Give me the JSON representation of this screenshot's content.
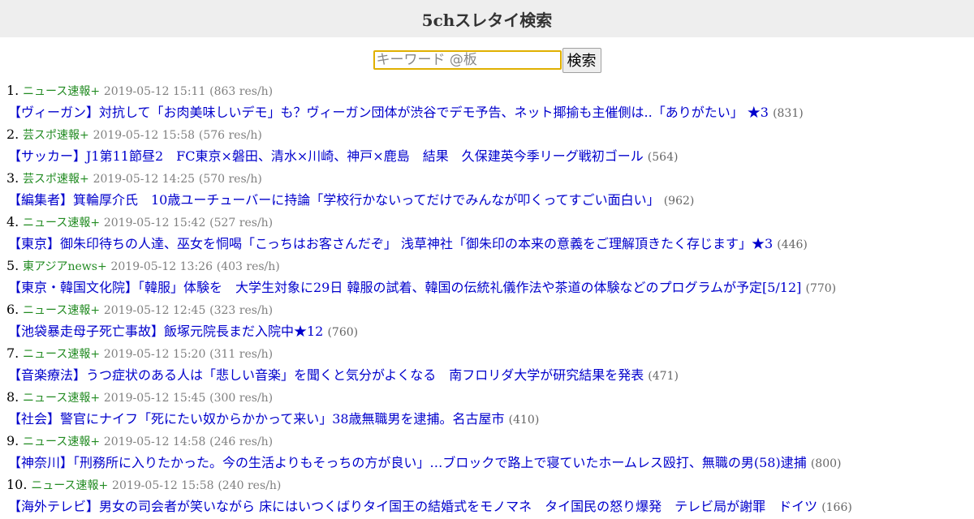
{
  "header": {
    "title": "5chスレタイ検索"
  },
  "search": {
    "placeholder": "キーワード @板",
    "button_label": "検索"
  },
  "threads": [
    {
      "num": "1.",
      "board": "ニュース速報+",
      "date": "2019-05-12 15:11",
      "rate": "(863 res/h)",
      "title": "【ヴィーガン】対抗して「お肉美味しいデモ」も？ヴィーガン団体が渋谷でデモ予告、ネット揶揄も主催側は..「ありがたい」 ★3",
      "count": "(831)"
    },
    {
      "num": "2.",
      "board": "芸スポ速報+",
      "date": "2019-05-12 15:58",
      "rate": "(576 res/h)",
      "title": "【サッカー】J1第11節昼2　FC東京×磐田、清水×川崎、神戸×鹿島　結果　久保建英今季リーグ戦初ゴール",
      "count": "(564)"
    },
    {
      "num": "3.",
      "board": "芸スポ速報+",
      "date": "2019-05-12 14:25",
      "rate": "(570 res/h)",
      "title": "【編集者】箕輪厚介氏　10歳ユーチューバーに持論「学校行かないってだけでみんなが叩くってすごい面白い」",
      "count": "(962)"
    },
    {
      "num": "4.",
      "board": "ニュース速報+",
      "date": "2019-05-12 15:42",
      "rate": "(527 res/h)",
      "title": "【東京】御朱印待ちの人達、巫女を恫喝「こっちはお客さんだぞ」 浅草神社「御朱印の本来の意義をご理解頂きたく存じます」★3",
      "count": "(446)"
    },
    {
      "num": "5.",
      "board": "東アジアnews+",
      "date": "2019-05-12 13:26",
      "rate": "(403 res/h)",
      "title": "【東京・韓国文化院】「韓服」体験を　大学生対象に29日 韓服の試着、韓国の伝統礼儀作法や茶道の体験などのプログラムが予定[5/12]",
      "count": "(770)"
    },
    {
      "num": "6.",
      "board": "ニュース速報+",
      "date": "2019-05-12 12:45",
      "rate": "(323 res/h)",
      "title": "【池袋暴走母子死亡事故】飯塚元院長まだ入院中★12",
      "count": "(760)"
    },
    {
      "num": "7.",
      "board": "ニュース速報+",
      "date": "2019-05-12 15:20",
      "rate": "(311 res/h)",
      "title": "【音楽療法】うつ症状のある人は「悲しい音楽」を聞くと気分がよくなる　南フロリダ大学が研究結果を発表",
      "count": "(471)"
    },
    {
      "num": "8.",
      "board": "ニュース速報+",
      "date": "2019-05-12 15:45",
      "rate": "(300 res/h)",
      "title": "【社会】警官にナイフ「死にたい奴からかかって来い」38歳無職男を逮捕。名古屋市",
      "count": "(410)"
    },
    {
      "num": "9.",
      "board": "ニュース速報+",
      "date": "2019-05-12 14:58",
      "rate": "(246 res/h)",
      "title": "【神奈川】「刑務所に入りたかった。今の生活よりもそっちの方が良い」…ブロックで路上で寝ていたホームレス殴打、無職の男(58)逮捕",
      "count": "(800)"
    },
    {
      "num": "10.",
      "board": "ニュース速報+",
      "date": "2019-05-12 15:58",
      "rate": "(240 res/h)",
      "title": "【海外テレビ】男女の司会者が笑いながら 床にはいつくばりタイ国王の結婚式をモノマネ　タイ国民の怒り爆発　テレビ局が謝罪　ドイツ",
      "count": "(166)"
    }
  ]
}
